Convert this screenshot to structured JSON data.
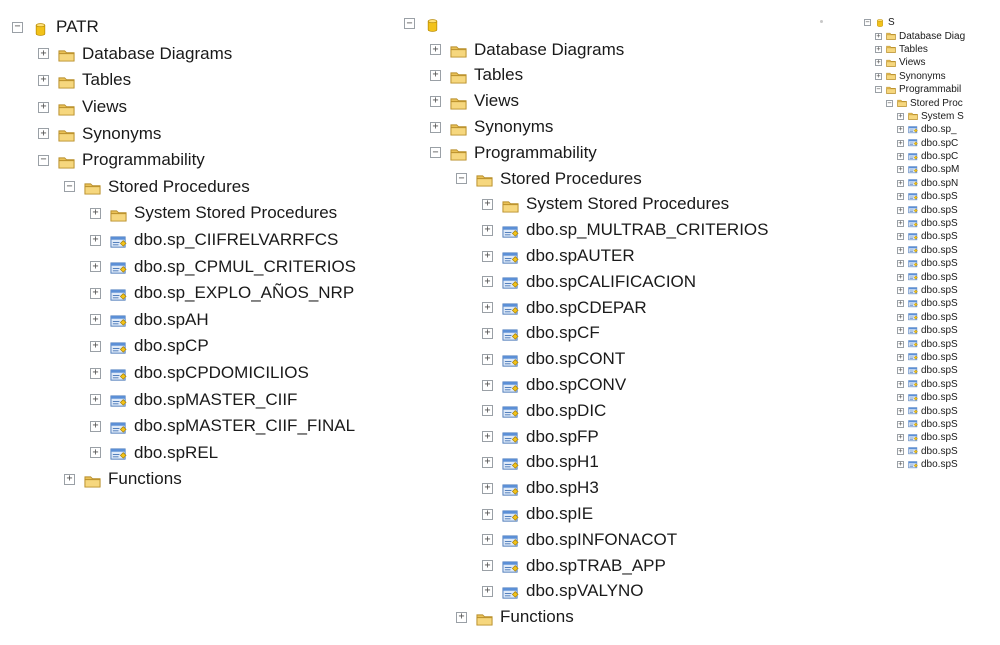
{
  "panels": [
    {
      "items": [
        {
          "level": 0,
          "expander": "−",
          "icon": "database-icon",
          "label": "PATR"
        },
        {
          "level": 1,
          "expander": "+",
          "icon": "folder-icon",
          "label": "Database Diagrams"
        },
        {
          "level": 1,
          "expander": "+",
          "icon": "folder-icon",
          "label": "Tables"
        },
        {
          "level": 1,
          "expander": "+",
          "icon": "folder-icon",
          "label": "Views"
        },
        {
          "level": 1,
          "expander": "+",
          "icon": "folder-icon",
          "label": "Synonyms"
        },
        {
          "level": 1,
          "expander": "−",
          "icon": "folder-icon",
          "label": "Programmability"
        },
        {
          "level": 2,
          "expander": "−",
          "icon": "folder-icon",
          "label": "Stored Procedures"
        },
        {
          "level": 3,
          "expander": "+",
          "icon": "folder-icon",
          "label": "System Stored Procedures"
        },
        {
          "level": 3,
          "expander": "+",
          "icon": "stored-procedure-icon",
          "label": "dbo.sp_CIIFRELVARRFCS"
        },
        {
          "level": 3,
          "expander": "+",
          "icon": "stored-procedure-icon",
          "label": "dbo.sp_CPMUL_CRITERIOS"
        },
        {
          "level": 3,
          "expander": "+",
          "icon": "stored-procedure-icon",
          "label": "dbo.sp_EXPLO_AÑOS_NRP"
        },
        {
          "level": 3,
          "expander": "+",
          "icon": "stored-procedure-icon",
          "label": "dbo.spAH"
        },
        {
          "level": 3,
          "expander": "+",
          "icon": "stored-procedure-icon",
          "label": "dbo.spCP"
        },
        {
          "level": 3,
          "expander": "+",
          "icon": "stored-procedure-icon",
          "label": "dbo.spCPDOMICILIOS"
        },
        {
          "level": 3,
          "expander": "+",
          "icon": "stored-procedure-icon",
          "label": "dbo.spMASTER_CIIF"
        },
        {
          "level": 3,
          "expander": "+",
          "icon": "stored-procedure-icon",
          "label": "dbo.spMASTER_CIIF_FINAL"
        },
        {
          "level": 3,
          "expander": "+",
          "icon": "stored-procedure-icon",
          "label": "dbo.spREL"
        },
        {
          "level": 2,
          "expander": "+",
          "icon": "folder-icon",
          "label": "Functions"
        }
      ]
    },
    {
      "items": [
        {
          "level": 0,
          "expander": "−",
          "icon": "database-icon",
          "label": ""
        },
        {
          "level": 1,
          "expander": "+",
          "icon": "folder-icon",
          "label": "Database Diagrams"
        },
        {
          "level": 1,
          "expander": "+",
          "icon": "folder-icon",
          "label": "Tables"
        },
        {
          "level": 1,
          "expander": "+",
          "icon": "folder-icon",
          "label": "Views"
        },
        {
          "level": 1,
          "expander": "+",
          "icon": "folder-icon",
          "label": "Synonyms"
        },
        {
          "level": 1,
          "expander": "−",
          "icon": "folder-icon",
          "label": "Programmability"
        },
        {
          "level": 2,
          "expander": "−",
          "icon": "folder-icon",
          "label": "Stored Procedures"
        },
        {
          "level": 3,
          "expander": "+",
          "icon": "folder-icon",
          "label": "System Stored Procedures"
        },
        {
          "level": 3,
          "expander": "+",
          "icon": "stored-procedure-icon",
          "label": "dbo.sp_MULTRAB_CRITERIOS"
        },
        {
          "level": 3,
          "expander": "+",
          "icon": "stored-procedure-icon",
          "label": "dbo.spAUTER"
        },
        {
          "level": 3,
          "expander": "+",
          "icon": "stored-procedure-icon",
          "label": "dbo.spCALIFICACION"
        },
        {
          "level": 3,
          "expander": "+",
          "icon": "stored-procedure-icon",
          "label": "dbo.spCDEPAR"
        },
        {
          "level": 3,
          "expander": "+",
          "icon": "stored-procedure-icon",
          "label": "dbo.spCF"
        },
        {
          "level": 3,
          "expander": "+",
          "icon": "stored-procedure-icon",
          "label": "dbo.spCONT"
        },
        {
          "level": 3,
          "expander": "+",
          "icon": "stored-procedure-icon",
          "label": "dbo.spCONV"
        },
        {
          "level": 3,
          "expander": "+",
          "icon": "stored-procedure-icon",
          "label": "dbo.spDIC"
        },
        {
          "level": 3,
          "expander": "+",
          "icon": "stored-procedure-icon",
          "label": "dbo.spFP"
        },
        {
          "level": 3,
          "expander": "+",
          "icon": "stored-procedure-icon",
          "label": "dbo.spH1"
        },
        {
          "level": 3,
          "expander": "+",
          "icon": "stored-procedure-icon",
          "label": "dbo.spH3"
        },
        {
          "level": 3,
          "expander": "+",
          "icon": "stored-procedure-icon",
          "label": "dbo.spIE"
        },
        {
          "level": 3,
          "expander": "+",
          "icon": "stored-procedure-icon",
          "label": "dbo.spINFONACOT"
        },
        {
          "level": 3,
          "expander": "+",
          "icon": "stored-procedure-icon",
          "label": "dbo.spTRAB_APP"
        },
        {
          "level": 3,
          "expander": "+",
          "icon": "stored-procedure-icon",
          "label": "dbo.spVALYNO"
        },
        {
          "level": 2,
          "expander": "+",
          "icon": "folder-icon",
          "label": "Functions"
        }
      ]
    },
    {
      "items": [
        {
          "level": 0,
          "expander": "−",
          "icon": "database-icon",
          "label": "S"
        },
        {
          "level": 1,
          "expander": "+",
          "icon": "folder-icon",
          "label": "Database Diag"
        },
        {
          "level": 1,
          "expander": "+",
          "icon": "folder-icon",
          "label": "Tables"
        },
        {
          "level": 1,
          "expander": "+",
          "icon": "folder-icon",
          "label": "Views"
        },
        {
          "level": 1,
          "expander": "+",
          "icon": "folder-icon",
          "label": "Synonyms"
        },
        {
          "level": 1,
          "expander": "−",
          "icon": "folder-icon",
          "label": "Programmabil"
        },
        {
          "level": 2,
          "expander": "−",
          "icon": "folder-icon",
          "label": "Stored Proc"
        },
        {
          "level": 3,
          "expander": "+",
          "icon": "folder-icon",
          "label": "System S"
        },
        {
          "level": 3,
          "expander": "+",
          "icon": "stored-procedure-icon",
          "label": "dbo.sp_"
        },
        {
          "level": 3,
          "expander": "+",
          "icon": "stored-procedure-icon",
          "label": "dbo.spC"
        },
        {
          "level": 3,
          "expander": "+",
          "icon": "stored-procedure-icon",
          "label": "dbo.spC"
        },
        {
          "level": 3,
          "expander": "+",
          "icon": "stored-procedure-icon",
          "label": "dbo.spM"
        },
        {
          "level": 3,
          "expander": "+",
          "icon": "stored-procedure-icon",
          "label": "dbo.spN"
        },
        {
          "level": 3,
          "expander": "+",
          "icon": "stored-procedure-icon",
          "label": "dbo.spS"
        },
        {
          "level": 3,
          "expander": "+",
          "icon": "stored-procedure-icon",
          "label": "dbo.spS"
        },
        {
          "level": 3,
          "expander": "+",
          "icon": "stored-procedure-icon",
          "label": "dbo.spS"
        },
        {
          "level": 3,
          "expander": "+",
          "icon": "stored-procedure-icon",
          "label": "dbo.spS"
        },
        {
          "level": 3,
          "expander": "+",
          "icon": "stored-procedure-icon",
          "label": "dbo.spS"
        },
        {
          "level": 3,
          "expander": "+",
          "icon": "stored-procedure-icon",
          "label": "dbo.spS"
        },
        {
          "level": 3,
          "expander": "+",
          "icon": "stored-procedure-icon",
          "label": "dbo.spS"
        },
        {
          "level": 3,
          "expander": "+",
          "icon": "stored-procedure-icon",
          "label": "dbo.spS"
        },
        {
          "level": 3,
          "expander": "+",
          "icon": "stored-procedure-icon",
          "label": "dbo.spS"
        },
        {
          "level": 3,
          "expander": "+",
          "icon": "stored-procedure-icon",
          "label": "dbo.spS"
        },
        {
          "level": 3,
          "expander": "+",
          "icon": "stored-procedure-icon",
          "label": "dbo.spS"
        },
        {
          "level": 3,
          "expander": "+",
          "icon": "stored-procedure-icon",
          "label": "dbo.spS"
        },
        {
          "level": 3,
          "expander": "+",
          "icon": "stored-procedure-icon",
          "label": "dbo.spS"
        },
        {
          "level": 3,
          "expander": "+",
          "icon": "stored-procedure-icon",
          "label": "dbo.spS"
        },
        {
          "level": 3,
          "expander": "+",
          "icon": "stored-procedure-icon",
          "label": "dbo.spS"
        },
        {
          "level": 3,
          "expander": "+",
          "icon": "stored-procedure-icon",
          "label": "dbo.spS"
        },
        {
          "level": 3,
          "expander": "+",
          "icon": "stored-procedure-icon",
          "label": "dbo.spS"
        },
        {
          "level": 3,
          "expander": "+",
          "icon": "stored-procedure-icon",
          "label": "dbo.spS"
        },
        {
          "level": 3,
          "expander": "+",
          "icon": "stored-procedure-icon",
          "label": "dbo.spS"
        },
        {
          "level": 3,
          "expander": "+",
          "icon": "stored-procedure-icon",
          "label": "dbo.spS"
        },
        {
          "level": 3,
          "expander": "+",
          "icon": "stored-procedure-icon",
          "label": "dbo.spS"
        }
      ]
    }
  ],
  "colors": {
    "database": "#e8b400",
    "folder": "#e2b640",
    "procedure": "#5b8fd6",
    "text": "#1a1a1a"
  }
}
